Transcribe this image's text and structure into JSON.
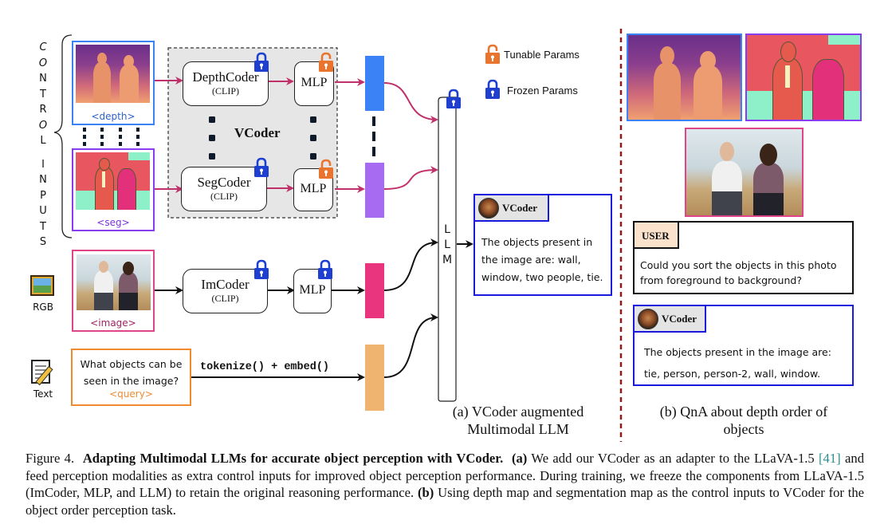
{
  "control_inputs_label": [
    "C",
    "O",
    "N",
    "T",
    "R",
    "O",
    "L",
    "",
    "I",
    "N",
    "P",
    "U",
    "T",
    "S"
  ],
  "inputs": {
    "depth_label": "<depth>",
    "seg_label": "<seg>",
    "image_label": "<image>",
    "query_label": "<query>",
    "query_text": "What objects can be seen in the image?",
    "rgb_icon_label": "RGB",
    "text_icon_label": "Text"
  },
  "vcoder": {
    "title": "VCoder",
    "depth_coder": {
      "name": "DepthCoder",
      "sub": "(CLIP)"
    },
    "seg_coder": {
      "name": "SegCoder",
      "sub": "(CLIP)"
    },
    "mlp_label": "MLP"
  },
  "imcoder": {
    "name": "ImCoder",
    "sub": "(CLIP)",
    "mlp_label": "MLP"
  },
  "tokenize_label": "tokenize() + embed()",
  "llm_label": [
    "L",
    "L",
    "M"
  ],
  "legend": {
    "tunable": "Tunable Params",
    "frozen": "Frozen Params"
  },
  "colors": {
    "depth_token": "#3b82f6",
    "seg_token": "#a66bf0",
    "image_token": "#e8357d",
    "text_token": "#f0b471",
    "tunable_lock": "#e8742e",
    "frozen_lock": "#1e3fd0",
    "control_arrow": "#c0306a",
    "chat_border": "#1a1adf",
    "divider": "#8b1a1a"
  },
  "chat_a": {
    "name": "VCoder",
    "text_lines": [
      "The objects present in",
      "the image are: wall,",
      "window, two people, tie."
    ]
  },
  "panel_b": {
    "user_label": "USER",
    "user_lines": [
      "Could you sort the objects in this photo",
      "from foreground to background?"
    ],
    "vcoder_name": "VCoder",
    "vcoder_lines": [
      "The objects present in the image are:",
      "tie, person, person-2, wall, window."
    ]
  },
  "subcaptions": {
    "a": [
      "(a) VCoder augmented",
      "Multimodal LLM"
    ],
    "b": [
      "(b) QnA about depth order of",
      "objects"
    ]
  },
  "caption": {
    "fig_label": "Figure 4.",
    "bold_title": "Adapting Multimodal LLMs for accurate object perception with VCoder.",
    "a_marker": "(a)",
    "a_text_1": "We add our VCoder as an adapter to the LLaVA-1.5",
    "citation": "[41]",
    "a_text_2": "and feed perception modalities as extra control inputs for improved object perception performance. During training, we freeze the components from LLaVA-1.5 (ImCoder, MLP, and LLM) to retain the original reasoning performance.",
    "b_marker": "(b)",
    "b_text": "Using depth map and segmentation map as the control inputs to VCoder for the object order perception task."
  }
}
